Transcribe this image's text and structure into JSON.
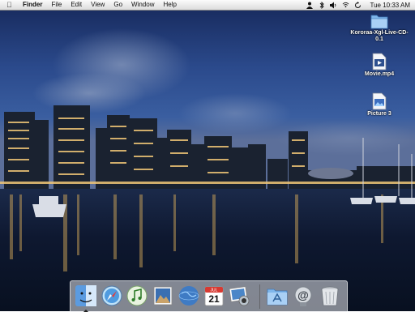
{
  "menubar": {
    "apple_label": "",
    "app_name": "Finder",
    "menus": [
      "File",
      "Edit",
      "View",
      "Go",
      "Window",
      "Help"
    ],
    "status_icons": [
      "user-icon",
      "bluetooth-icon",
      "volume-icon",
      "wifi-icon",
      "sync-icon"
    ],
    "clock": "Tue 10:33 AM"
  },
  "desktop": {
    "icons": [
      {
        "name": "folder-icon",
        "label": "Kororaa-Xgl-Live-CD-0.1"
      },
      {
        "name": "movie-file-icon",
        "label": "Movie.mp4"
      },
      {
        "name": "picture-file-icon",
        "label": "Picture 3"
      }
    ]
  },
  "dock": {
    "apps": [
      "finder-icon",
      "safari-icon",
      "itunes-icon",
      "preview-icon",
      "network-globe-icon",
      "ical-icon",
      "iphoto-icon"
    ],
    "calendar_day": "21",
    "calendar_month": "JUL",
    "others": [
      "applications-folder-icon",
      "mail-icon",
      "trash-icon"
    ]
  },
  "colors": {
    "sky_top": "#1e2f63",
    "sky_mid": "#2d4a86",
    "water": "#0c1424"
  }
}
